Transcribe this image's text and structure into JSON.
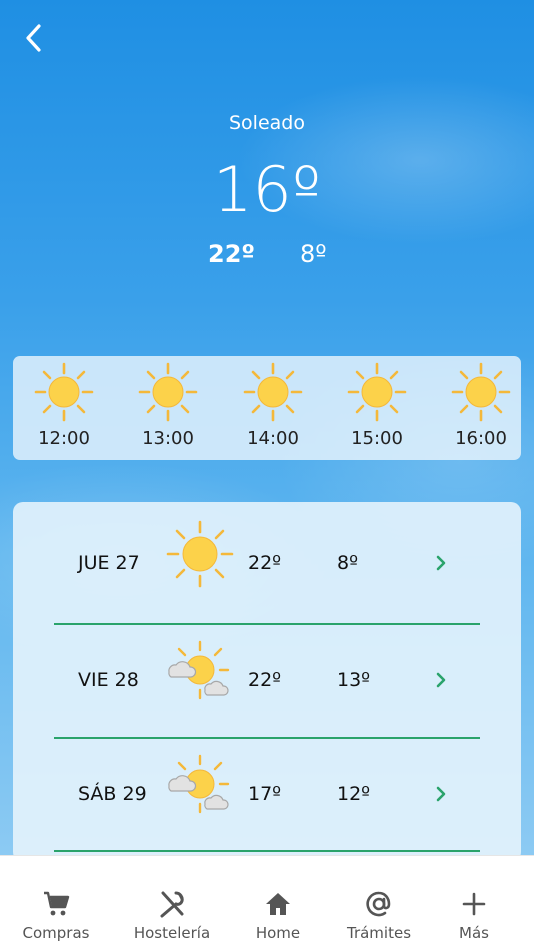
{
  "header": {
    "back_icon": "chevron-left-icon"
  },
  "current": {
    "condition": "Soleado",
    "temperature": "16º",
    "max": "22º",
    "min": "8º"
  },
  "hourly": [
    {
      "time": "12:00",
      "icon": "sun-icon"
    },
    {
      "time": "13:00",
      "icon": "sun-icon"
    },
    {
      "time": "14:00",
      "icon": "sun-icon"
    },
    {
      "time": "15:00",
      "icon": "sun-icon"
    },
    {
      "time": "16:00",
      "icon": "sun-icon"
    }
  ],
  "daily": [
    {
      "day": "JUE 27",
      "icon": "sun-icon",
      "max": "22º",
      "min": "8º"
    },
    {
      "day": "VIE 28",
      "icon": "partly-cloudy-icon",
      "max": "22º",
      "min": "13º"
    },
    {
      "day": "SÁB 29",
      "icon": "partly-cloudy-icon",
      "max": "17º",
      "min": "12º"
    }
  ],
  "tabs": [
    {
      "label": "Compras",
      "icon": "cart-icon"
    },
    {
      "label": "Hostelería",
      "icon": "utensils-icon"
    },
    {
      "label": "Home",
      "icon": "home-icon"
    },
    {
      "label": "Trámites",
      "icon": "at-icon"
    },
    {
      "label": "Más",
      "icon": "plus-icon"
    }
  ],
  "colors": {
    "accent": "#2aa36b",
    "sun": "#fcd24a",
    "ray": "#f4b83a",
    "tab_icon": "#555555"
  }
}
